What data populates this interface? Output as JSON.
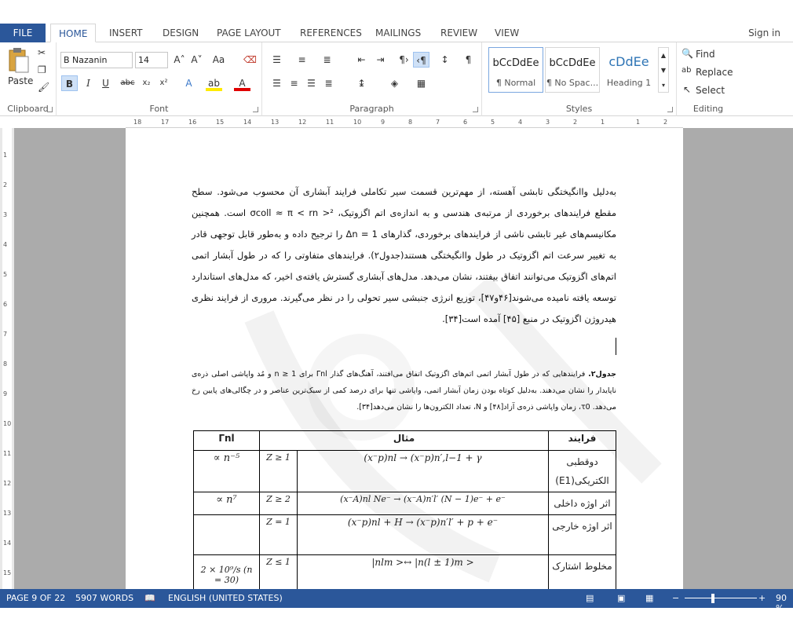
{
  "tabs": {
    "file": "FILE",
    "items": [
      "HOME",
      "INSERT",
      "DESIGN",
      "PAGE LAYOUT",
      "REFERENCES",
      "MAILINGS",
      "REVIEW",
      "VIEW"
    ],
    "active": "HOME",
    "signin": "Sign in"
  },
  "ribbon": {
    "clipboard": {
      "paste": "Paste",
      "label": "Clipboard"
    },
    "font": {
      "name": "B Nazanin",
      "size": "14",
      "label": "Font"
    },
    "paragraph": {
      "label": "Paragraph"
    },
    "styles": {
      "label": "Styles",
      "items": [
        {
          "sample": "bCcDdEe",
          "name": "¶ Normal"
        },
        {
          "sample": "bCcDdEe",
          "name": "¶ No Spac..."
        },
        {
          "sample": "cDdEe",
          "name": "Heading 1"
        }
      ]
    },
    "editing": {
      "find": "Find",
      "replace": "Replace",
      "select": "Select",
      "label": "Editing"
    }
  },
  "ruler": {
    "h": [
      "18",
      "17",
      "16",
      "15",
      "14",
      "13",
      "12",
      "11",
      "10",
      "9",
      "8",
      "7",
      "6",
      "5",
      "4",
      "3",
      "2",
      "1",
      "1",
      "2"
    ],
    "v": [
      "1",
      "2",
      "3",
      "4",
      "5",
      "6",
      "7",
      "8",
      "9",
      "10",
      "11",
      "12",
      "13",
      "14",
      "15"
    ]
  },
  "document": {
    "paragraph": "به‌دلیل واانگیختگی تابشی آهسته، از مهم‌ترین قسمت سیر تکاملی فرایند آبشاری آن محسوب می‌شود. سطح مقطع فرایندهای برخوردی از مرتبه‌ی هندسی و به اندازه‌ی اتم اگزوتیک، σcoll ≈ π < rn >² است. همچنین مکانیسم‌های غیر تابشی ناشی از فرایندهای برخوردی، گذارهای Δn = 1 را ترجیح داده و به‌طور قابل توجهی قادر به تغییر سرعت اتم اگزوتیک در طول واانگیختگی هستند(جدول۲). فرایندهای متفاوتی را که در طول آبشار اتمی اتم‌های اگزوتیک می‌توانند اتفاق بیفتند، نشان می‌دهد. مدل‌های آبشاری گسترش یافته‌ی اخیر، که مدل‌های استاندارد توسعه یافته نامیده می‌شوند[۴۶و۴۷]، توزیع انرژی جنبشی سیر تحولی را در نظر می‌گیرند. مروری از فرایند نظری هیدروژن اگزوتیک در منبع [۴۵] آمده است[۳۴].",
    "caption_bold": "جدول۲.",
    "caption": " فرایندهایی که در طول آبشار اتمی اتم‌های اگزوتیک اتفاق می‌افتند، آهنگ‌های گذار Γnl برای n ≥ 1 و مُد واپاشی اصلی ذره‌ی ناپایدار را نشان می‌دهند. به‌دلیل کوتاه بودن زمان آبشار اتمی، واپاشی تنها برای درصد کمی از سبک‌ترین عناصر و در چگالی‌های پایین رخ می‌دهد. τ0، زمان واپاشی ذره‌ی آزاد[۴۸] و N، تعداد الکترون‌ها را نشان می‌دهد[۳۴].",
    "table": {
      "headers": {
        "process": "فرایند",
        "example": "مثال",
        "gamma": "Γnl"
      },
      "rows": [
        {
          "process": "دوقطبی الکتریکی(E1)",
          "example": "(x⁻p)nl → (x⁻p)n′,l−1 + γ",
          "z": "Z ≥ 1",
          "gamma": "∝ n⁻⁵"
        },
        {
          "process": "اثر اوژه داخلی",
          "example": "(x⁻A)nl Ne⁻ → (x⁻A)n′l′ (N − 1)e⁻ + e⁻",
          "z": "Z ≥ 2",
          "gamma": "∝ n⁷"
        },
        {
          "process": "اثر اوژه خارجی",
          "example": "(x⁻p)nl + H → (x⁻p)n′l′ + p + e⁻",
          "z": "Z = 1",
          "gamma": ""
        },
        {
          "process": "مخلوط اشتارک",
          "example": "|nlm >↔ |n(l ± 1)m >",
          "z": "Z ≤ 1",
          "gamma": "2 × 10⁹/s (n = 30)"
        }
      ]
    }
  },
  "status": {
    "page": "PAGE 9 OF 22",
    "words": "5907 WORDS",
    "language": "ENGLISH (UNITED STATES)",
    "zoom": "90 %"
  },
  "colors": {
    "brand": "#2b579a",
    "workspace": "#ababab"
  }
}
